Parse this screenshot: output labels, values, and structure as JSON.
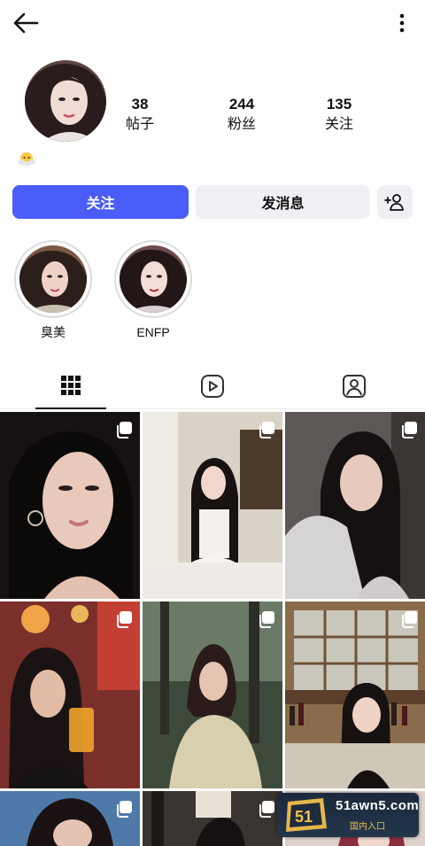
{
  "header": {
    "back_icon": "arrow-left-icon",
    "more_icon": "more-vertical-icon"
  },
  "profile": {
    "stats": [
      {
        "value": "38",
        "label": "帖子"
      },
      {
        "value": "244",
        "label": "粉丝"
      },
      {
        "value": "135",
        "label": "关注"
      }
    ],
    "bio_emoji": "😶‍🌫️"
  },
  "actions": {
    "follow_label": "关注",
    "message_label": "发消息",
    "add_friend_icon": "person-add-icon"
  },
  "highlights": [
    {
      "label": "臭美"
    },
    {
      "label": "ENFP"
    }
  ],
  "tabs": [
    {
      "icon": "grid-icon",
      "active": true
    },
    {
      "icon": "reels-play-icon",
      "active": false
    },
    {
      "icon": "tagged-person-icon",
      "active": false
    }
  ],
  "posts_multi_icon": "carousel-icon",
  "colors": {
    "accent": "#4a5df9",
    "button_secondary": "#efeff4",
    "tab_indicator": "#111111"
  },
  "watermark": {
    "logo_text": "51",
    "title": "51awn5.com",
    "subtitle": "国内入口"
  }
}
